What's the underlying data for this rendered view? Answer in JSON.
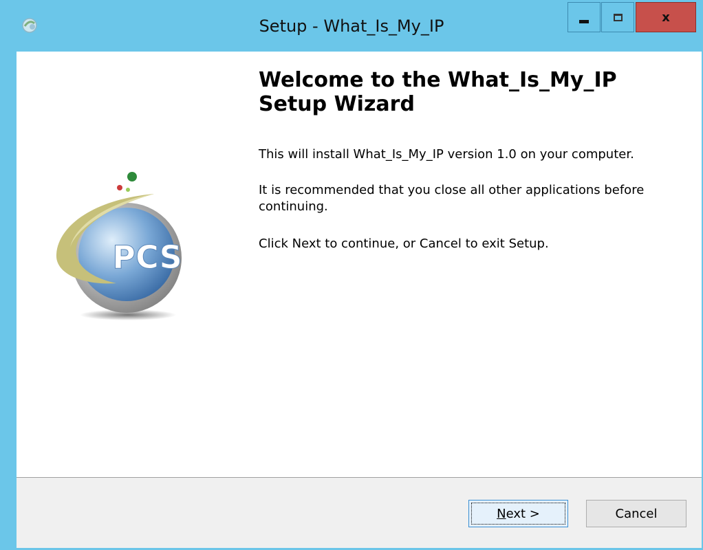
{
  "window": {
    "title": "Setup - What_Is_My_IP",
    "controls": {
      "minimize": "",
      "maximize": "",
      "close": "x"
    }
  },
  "wizard": {
    "heading": "Welcome to the What_Is_My_IP Setup Wizard",
    "paragraphs": [
      "This will install What_Is_My_IP version 1.0 on your computer.",
      "It is recommended that you close all other applications before continuing.",
      "Click Next to continue, or Cancel to exit Setup."
    ],
    "logo_text": "PCS"
  },
  "buttons": {
    "next_mnemonic": "N",
    "next_rest": "ext >",
    "cancel": "Cancel"
  },
  "colors": {
    "titlebar": "#6bc6e9",
    "close": "#c7504b",
    "footer": "#f0f0f0"
  }
}
